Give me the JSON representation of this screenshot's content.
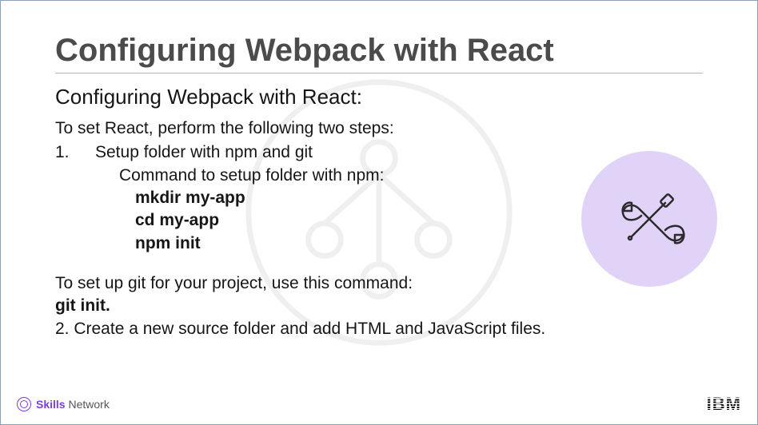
{
  "title": "Configuring Webpack with React",
  "subtitle": "Configuring Webpack with React:",
  "intro": "To set React, perform the following two steps:",
  "step1_num": "1.",
  "step1_text": "Setup folder with npm and git",
  "step1_sub": "Command to setup folder with npm:",
  "cmd1": "mkdir my-app",
  "cmd2": "cd my-app",
  "cmd3": "npm init",
  "git_intro": "To set up git for your project, use this command:",
  "git_cmd": "git init.",
  "step2": "2. Create a new source folder and add HTML and JavaScript files.",
  "footer_skills": "Skills",
  "footer_network": " Network",
  "footer_ibm": "IBM"
}
